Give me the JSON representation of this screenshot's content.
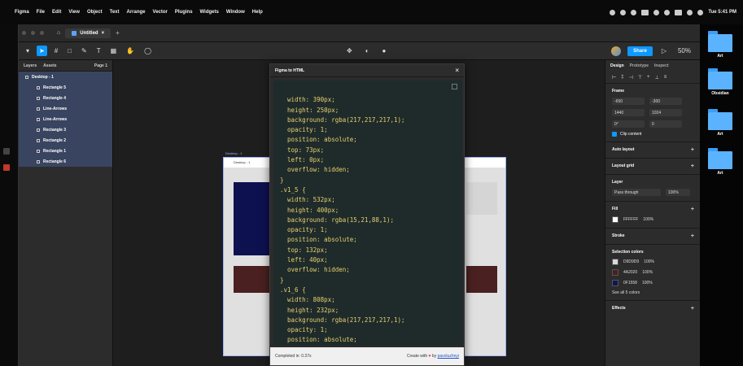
{
  "menubar": {
    "app": "Figma",
    "items": [
      "File",
      "Edit",
      "View",
      "Object",
      "Text",
      "Arrange",
      "Vector",
      "Plugins",
      "Widgets",
      "Window",
      "Help"
    ],
    "clock": "Tue 5:41 PM"
  },
  "figma": {
    "tab_title": "Untitled",
    "layers_tabs": [
      "Layers",
      "Assets"
    ],
    "page_label": "Page 1",
    "frame_layer": "Desktop - 1",
    "layers": [
      "Rectangle 5",
      "Rectangle 4",
      "Line-Arrows",
      "Line-Arrows",
      "Rectangle 3",
      "Rectangle 2",
      "Rectangle 1",
      "Rectangle 6"
    ],
    "share_label": "Share",
    "zoom": "50%",
    "frame_header": "Desktop - 1"
  },
  "plugin": {
    "title": "Figma to HTML",
    "code": [
      "  width: 390px;",
      "  height: 250px;",
      "  background: rgba(217,217,217,1);",
      "  opacity: 1;",
      "  position: absolute;",
      "  top: 73px;",
      "  left: 0px;",
      "  overflow: hidden;",
      "}",
      ".v1_5 {",
      "  width: 532px;",
      "  height: 400px;",
      "  background: rgba(15,21,88,1);",
      "  opacity: 1;",
      "  position: absolute;",
      "  top: 132px;",
      "  left: 40px;",
      "  overflow: hidden;",
      "}",
      ".v1_6 {",
      "  width: 808px;",
      "  height: 232px;",
      "  background: rgba(217,217,217,1);",
      "  opacity: 1;",
      "  position: absolute;"
    ],
    "footer_left": "Completed in: 0.37s",
    "footer_made": "Create with",
    "footer_by": "by",
    "footer_author": "pavoluzhnyi"
  },
  "props": {
    "tabs": [
      "Design",
      "Prototype",
      "Inspect"
    ],
    "frame_label": "Frame",
    "x": "-650",
    "y": "-300",
    "w": "1440",
    "h": "1024",
    "rotation": "0°",
    "radius": "0",
    "clip_label": "Clip content",
    "auto_layout": "Auto layout",
    "layout_grid": "Layout grid",
    "layer_label": "Layer",
    "pass_through": "Pass through",
    "opacity": "100%",
    "fill_label": "Fill",
    "fill_hex": "FFFFFF",
    "fill_opacity": "100%",
    "stroke_label": "Stroke",
    "selection_colors": "Selection colors",
    "colors": [
      {
        "hex": "D9D9D9",
        "pct": "100%",
        "swatch": "#d9d9d9"
      },
      {
        "hex": "4A2020",
        "pct": "100%",
        "swatch": "#4a2020"
      },
      {
        "hex": "0F1558",
        "pct": "100%",
        "swatch": "#0f1558"
      }
    ],
    "see_all": "See all 5 colors",
    "effects_label": "Effects"
  },
  "desktop": {
    "folders": [
      "Art",
      "Obsidian",
      "Art",
      "Art"
    ]
  }
}
